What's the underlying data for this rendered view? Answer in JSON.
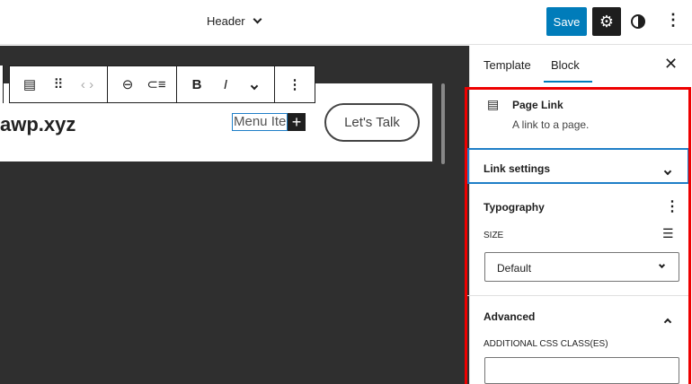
{
  "header": {
    "title": "Header",
    "save_label": "Save"
  },
  "canvas": {
    "site_title": "awp.xyz",
    "menu_item": "Menu Item",
    "cta": "Let's  Talk"
  },
  "toolbar": {
    "bold": "B",
    "italic": "I"
  },
  "sidebar": {
    "tabs": [
      {
        "label": "Template"
      },
      {
        "label": "Block",
        "active": true
      }
    ],
    "block": {
      "name": "Page Link",
      "description": "A link to a page."
    },
    "link_settings": "Link settings",
    "typography": {
      "label": "Typography",
      "size_label": "SIZE",
      "size_value": "Default"
    },
    "advanced": {
      "label": "Advanced",
      "css_label": "ADDITIONAL CSS CLASS(ES)",
      "css_value": ""
    }
  },
  "colors": {
    "accent": "#007cba",
    "highlight": "#e00000"
  }
}
